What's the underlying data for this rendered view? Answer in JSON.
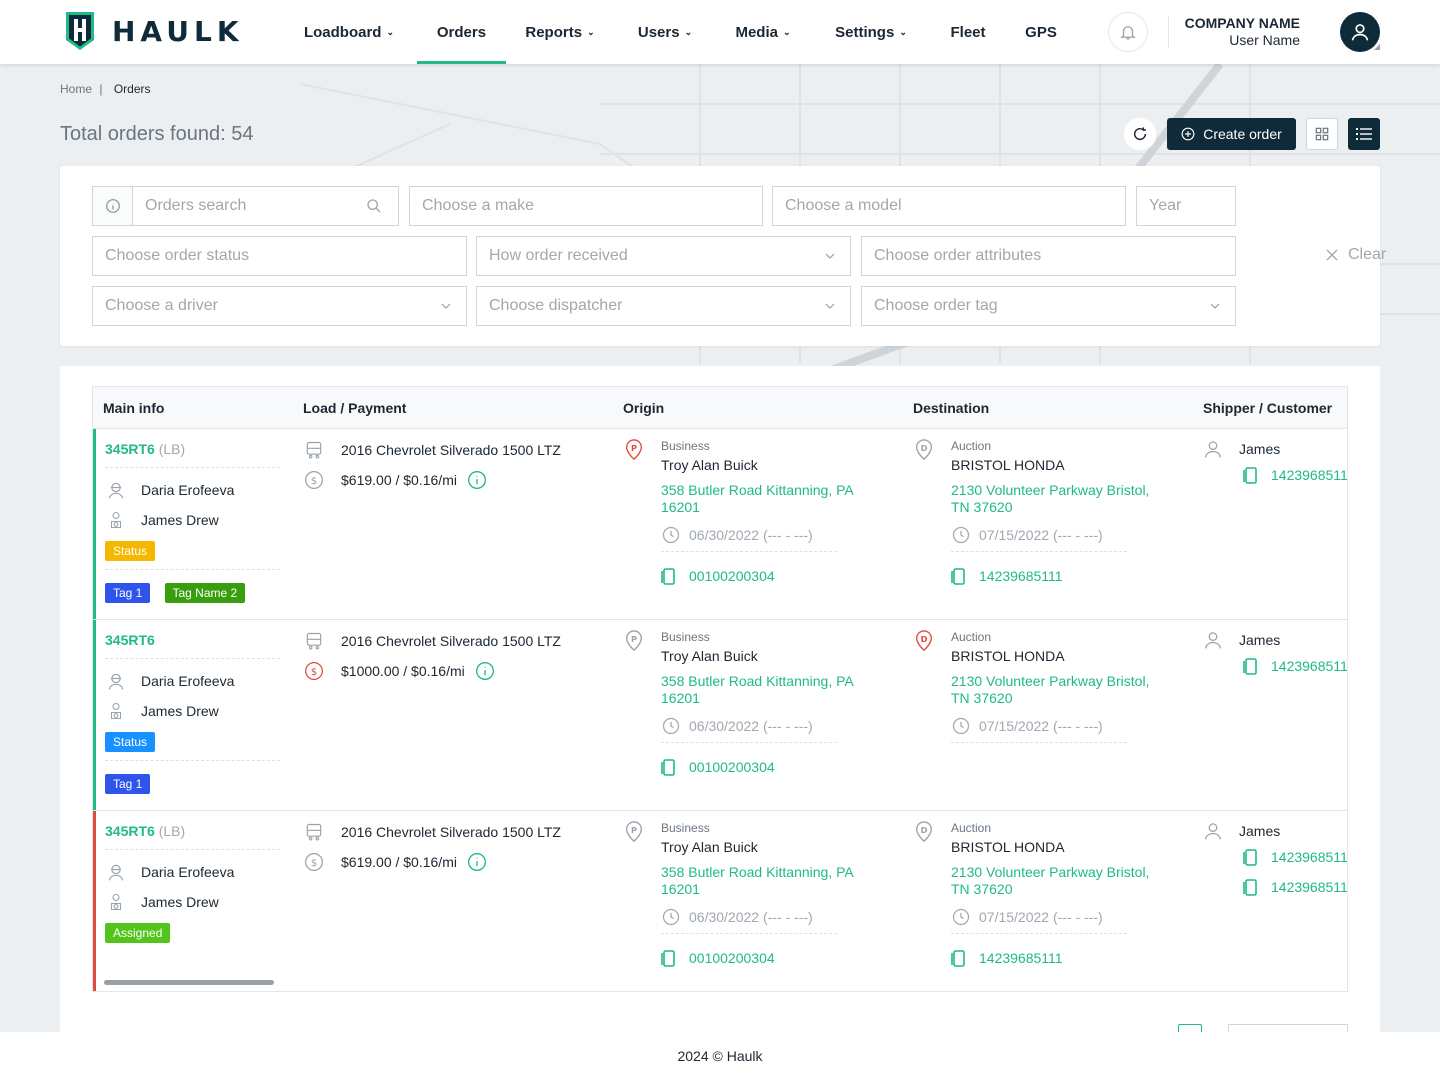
{
  "brand": {
    "name": "HAULK"
  },
  "nav": {
    "items": [
      {
        "label": "Loadboard",
        "has_dropdown": true
      },
      {
        "label": "Orders",
        "has_dropdown": false,
        "active": true
      },
      {
        "label": "Reports",
        "has_dropdown": true
      },
      {
        "label": "Users",
        "has_dropdown": true
      },
      {
        "label": "Media",
        "has_dropdown": true
      },
      {
        "label": "Settings",
        "has_dropdown": true
      },
      {
        "label": "Fleet",
        "has_dropdown": false
      },
      {
        "label": "GPS",
        "has_dropdown": false
      }
    ]
  },
  "account": {
    "company": "COMPANY NAME",
    "user": "User Name"
  },
  "breadcrumb": {
    "home": "Home",
    "separator": "|",
    "current": "Orders"
  },
  "summary": {
    "total_label": "Total orders found: 54"
  },
  "actions": {
    "create_order": "Create order"
  },
  "filters": {
    "search_placeholder": "Orders search",
    "make_placeholder": "Choose a make",
    "model_placeholder": "Choose a model",
    "year_placeholder": "Year",
    "status_placeholder": "Choose order status",
    "received_placeholder": "How order received",
    "attributes_placeholder": "Choose order attributes",
    "driver_placeholder": "Choose a driver",
    "dispatcher_placeholder": "Choose dispatcher",
    "tag_placeholder": "Choose order tag",
    "clear_label": "Clear"
  },
  "table": {
    "headers": [
      "Main info",
      "Load / Payment",
      "Origin",
      "Destination",
      "Shipper / Customer"
    ],
    "rows": [
      {
        "id": "345RT6",
        "lb": "(LB)",
        "accent": "#1fb98a",
        "dispatcher": "Daria Erofeeva",
        "driver": "James Drew",
        "status": {
          "label": "Status",
          "color": "#f5b800"
        },
        "tags": [
          {
            "label": "Tag 1",
            "color": "#2f54eb"
          },
          {
            "label": "Tag Name 2",
            "color": "#389e0d"
          }
        ],
        "vehicle": "2016 Chevrolet Silverado 1500 LTZ",
        "payment": "$619.00 / $0.16/mi",
        "payment_alert": false,
        "origin": {
          "type": "Business",
          "name": "Troy Alan Buick",
          "address": "358 Butler Road Kittanning, PA 16201",
          "date": "06/30/2022 (--- - ---)",
          "phone": "00100200304",
          "icon_alert": true
        },
        "destination": {
          "type": "Auction",
          "name": "BRISTOL HONDA",
          "address": "2130 Volunteer Parkway Bristol, TN 37620",
          "date": "07/15/2022 (--- - ---)",
          "phone": "14239685111",
          "icon_alert": false
        },
        "shipper": {
          "name": "James",
          "phones": [
            "1423968511"
          ]
        }
      },
      {
        "id": "345RT6",
        "lb": "",
        "accent": "#1fb98a",
        "dispatcher": "Daria Erofeeva",
        "driver": "James Drew",
        "status": {
          "label": "Status",
          "color": "#1890ff"
        },
        "tags": [
          {
            "label": "Tag 1",
            "color": "#2f54eb"
          }
        ],
        "vehicle": "2016 Chevrolet Silverado 1500 LTZ",
        "payment": "$1000.00 / $0.16/mi",
        "payment_alert": true,
        "origin": {
          "type": "Business",
          "name": "Troy Alan Buick",
          "address": "358 Butler Road Kittanning, PA 16201",
          "date": "06/30/2022 (--- - ---)",
          "phone": "00100200304",
          "icon_alert": false
        },
        "destination": {
          "type": "Auction",
          "name": "BRISTOL HONDA",
          "address": "2130 Volunteer Parkway Bristol, TN 37620",
          "date": "07/15/2022 (--- - ---)",
          "phone": "",
          "icon_alert": true
        },
        "shipper": {
          "name": "James",
          "phones": [
            "1423968511"
          ]
        }
      },
      {
        "id": "345RT6",
        "lb": "(LB)",
        "accent": "#e04b3c",
        "dispatcher": "Daria Erofeeva",
        "driver": "James Drew",
        "status": {
          "label": "Assigned",
          "color": "#52c41a"
        },
        "tags": [],
        "vehicle": "2016 Chevrolet Silverado 1500 LTZ",
        "payment": "$619.00 / $0.16/mi",
        "payment_alert": false,
        "origin": {
          "type": "Business",
          "name": "Troy Alan Buick",
          "address": "358 Butler Road Kittanning, PA 16201",
          "date": "06/30/2022 (--- - ---)",
          "phone": "00100200304",
          "icon_alert": false
        },
        "destination": {
          "type": "Auction",
          "name": "BRISTOL HONDA",
          "address": "2130 Volunteer Parkway Bristol, TN 37620",
          "date": "07/15/2022 (--- - ---)",
          "phone": "14239685111",
          "icon_alert": false
        },
        "shipper": {
          "name": "James",
          "phones": [
            "1423968511",
            "1423968511"
          ]
        }
      }
    ]
  },
  "footer": {
    "text": "2024 © Haulk"
  },
  "colors": {
    "accent": "#1fb98a",
    "navy": "#0f2b3a",
    "alert": "#e04b3c"
  }
}
